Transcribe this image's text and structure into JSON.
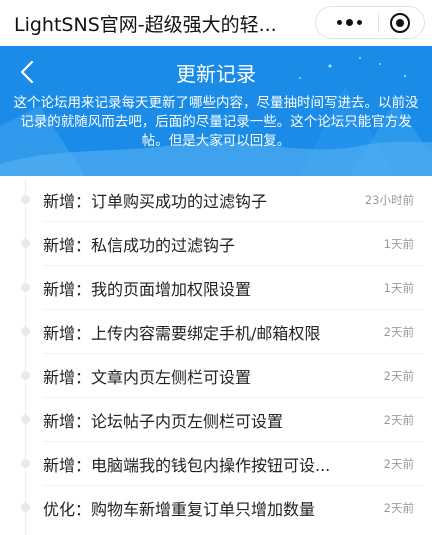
{
  "window": {
    "title": "LightSNS官网-超级强大的轻...",
    "menu_icon": "more-dots-icon",
    "close_icon": "target-circle-icon"
  },
  "header": {
    "back_icon": "chevron-left-icon",
    "title": "更新记录",
    "description": "这个论坛用来记录每天更新了哪些内容，尽量抽时间写进去。以前没记录的就随风而去吧，后面的尽量记录一些。这个论坛只能官方发帖。但是大家可以回复。",
    "bg_color": "#1a8ce8"
  },
  "posts": [
    {
      "title": "新增：订单购买成功的过滤钩子",
      "time": "23小时前"
    },
    {
      "title": "新增：私信成功的过滤钩子",
      "time": "1天前"
    },
    {
      "title": "新增：我的页面增加权限设置",
      "time": "1天前"
    },
    {
      "title": "新增：上传内容需要绑定手机/邮箱权限",
      "time": "2天前"
    },
    {
      "title": "新增：文章内页左侧栏可设置",
      "time": "2天前"
    },
    {
      "title": "新增：论坛帖子内页左侧栏可设置",
      "time": "2天前"
    },
    {
      "title": "新增：电脑端我的钱包内操作按钮可设...",
      "time": "2天前"
    },
    {
      "title": "优化：购物车新增重复订单只增加数量",
      "time": "2天前"
    }
  ]
}
